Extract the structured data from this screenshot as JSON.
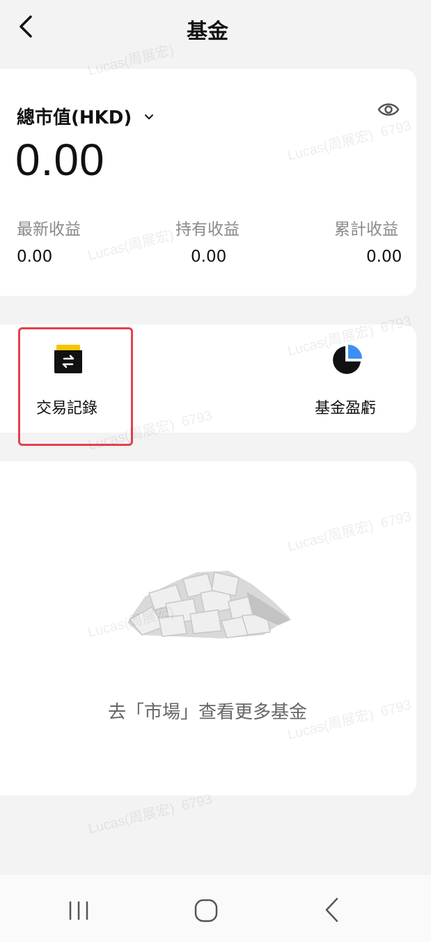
{
  "header": {
    "title": "基金",
    "back_icon": "chevron-left-icon"
  },
  "summary": {
    "total_label": "總市值(HKD)",
    "total_value": "0.00",
    "stats": [
      {
        "label": "最新收益",
        "value": "0.00"
      },
      {
        "label": "持有收益",
        "value": "0.00"
      },
      {
        "label": "累計收益",
        "value": "0.00"
      }
    ]
  },
  "shortcuts": [
    {
      "label": "交易記錄",
      "icon": "transaction-records-icon"
    },
    {
      "label": "基金盈虧",
      "icon": "pie-chart-icon"
    }
  ],
  "empty_state": {
    "text": "去「市場」查看更多基金",
    "icon": "paper-pile-illustration"
  },
  "watermark": {
    "name": "Lucas(周展宏)",
    "id": "6793"
  },
  "colors": {
    "highlight": "#e5414a",
    "icon_yellow": "#f7c600",
    "pie_blue": "#3b8ff2"
  }
}
